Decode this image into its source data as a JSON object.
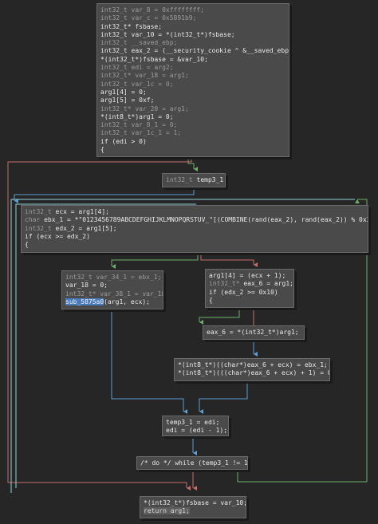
{
  "theme": {
    "background": "#262626",
    "node_fill": "#4a4a4a",
    "node_border": "#6a6a6a",
    "edge_true": "#6fae6f",
    "edge_false": "#c86e6e",
    "edge_uncond": "#5e9ed2",
    "edge_back": "#8fd0d8",
    "highlight": "#4a7ab8"
  },
  "nodes": {
    "entry": [
      [
        [
          "t",
          "int32_t var_8 = 0xffffffff;"
        ]
      ],
      [
        [
          "t",
          "int32_t var_c = 0x5891b9;"
        ]
      ],
      [
        [
          "c",
          "int32_t* fsbase;"
        ]
      ],
      [
        [
          "c",
          "int32_t var_10 = *(int32_t*)fsbase;"
        ]
      ],
      [
        [
          "t",
          "int32_t __saved_ebp;"
        ]
      ],
      [
        [
          "c",
          "int32_t eax_2 = (__security_cookie ^ &__saved_ebp);"
        ]
      ],
      [
        [
          "c",
          "*(int32_t*)fsbase = &var_10;"
        ]
      ],
      [
        [
          "t",
          "int32_t edi = arg2;"
        ]
      ],
      [
        [
          "t",
          "int32_t* var_18 = arg1;"
        ]
      ],
      [
        [
          "t",
          "int32_t var_1c = 0;"
        ]
      ],
      [
        [
          "c",
          "arg1[4] = 0;"
        ]
      ],
      [
        [
          "c",
          "arg1[5] = 0xf;"
        ]
      ],
      [
        [
          "t",
          "int32_t* var_20 = arg1;"
        ]
      ],
      [
        [
          "c",
          "*(int8_t*)arg1 = 0;"
        ]
      ],
      [
        [
          "t",
          "int32_t var_8_1 = 0;"
        ]
      ],
      [
        [
          "t",
          "int32_t var_1c_1 = 1;"
        ]
      ],
      [
        [
          "c",
          "if (edi > 0)"
        ]
      ],
      [
        [
          "c",
          "{"
        ]
      ]
    ],
    "temp": [
      [
        [
          "t",
          "int32_t "
        ],
        [
          "c",
          "temp3_1;"
        ]
      ]
    ],
    "loop_head": [
      [
        [
          "t",
          "int32_t "
        ],
        [
          "c",
          "ecx = arg1[4];"
        ]
      ],
      [
        [
          "t",
          "char "
        ],
        [
          "c",
          "ebx_1 = *\"0123456789ABCDEFGHIJKLMNOPQRSTUV_\"[(COMBINE(rand(eax_2), rand(eax_2)) % 0x3e)];"
        ]
      ],
      [
        [
          "t",
          "int32_t "
        ],
        [
          "c",
          "edx_2 = arg1[5];"
        ]
      ],
      [
        [
          "c",
          "if (ecx >= edx_2)"
        ]
      ],
      [
        [
          "c",
          "{"
        ]
      ]
    ],
    "call_block": [
      [
        [
          "t",
          "int32_t var_34_1 = ebx_1;"
        ]
      ],
      [
        [
          "c",
          "var_18 = 0;"
        ]
      ],
      [
        [
          "t",
          "int32_t* var_38_1 = var_18;"
        ]
      ],
      [
        [
          "h",
          "sub_5875a0"
        ],
        [
          "c",
          "(arg1, ecx);"
        ]
      ]
    ],
    "else_block": [
      [
        [
          "c",
          "arg1[4] = (ecx + 1);"
        ]
      ],
      [
        [
          "t",
          "int32_t* "
        ],
        [
          "c",
          "eax_6 = arg1;"
        ]
      ],
      [
        [
          "c",
          "if (edx_2 >= 0x10)"
        ]
      ],
      [
        [
          "c",
          "{"
        ]
      ]
    ],
    "deref": [
      [
        [
          "c",
          "eax_6 = *(int32_t*)arg1;"
        ]
      ]
    ],
    "store": [
      [
        [
          "c",
          "*(int8_t*)((char*)eax_6 + ecx) = ebx_1;"
        ]
      ],
      [
        [
          "c",
          "*(int8_t*)(((char*)eax_6 + ecx) + 1) = 0;"
        ]
      ]
    ],
    "dec": [
      [
        [
          "c",
          "temp3_1 = edi;"
        ]
      ],
      [
        [
          "c",
          "edi = (edi - 1);"
        ]
      ]
    ],
    "while": [
      [
        [
          "c",
          "/* do */ while (temp3_1 != 1)"
        ]
      ]
    ],
    "ret": [
      [
        [
          "c",
          "*(int32_t*)fsbase = var_10;"
        ]
      ],
      [
        [
          "x",
          "return arg1;"
        ]
      ]
    ]
  }
}
